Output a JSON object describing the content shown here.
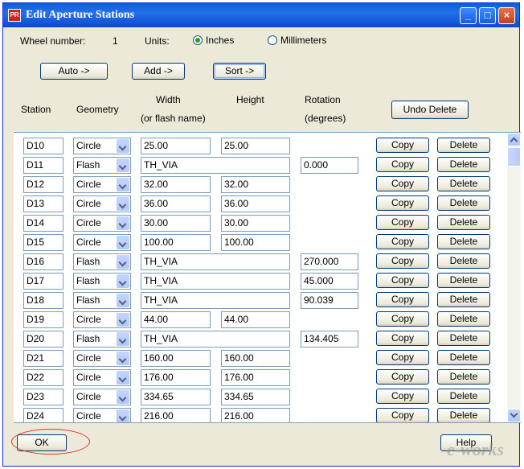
{
  "window": {
    "title": "Edit Aperture Stations",
    "controls": [
      "_",
      "□",
      "×"
    ]
  },
  "header": {
    "wheel_label": "Wheel number:",
    "wheel_value": "1",
    "units_label": "Units:",
    "units_options": [
      "Inches",
      "Millimeters"
    ],
    "units_selected": "Inches"
  },
  "toolbar": {
    "auto_label": "Auto ->",
    "add_label": "Add ->",
    "sort_label": "Sort ->",
    "undo_delete_label": "Undo Delete"
  },
  "columns": {
    "station": "Station",
    "geometry": "Geometry",
    "width": "Width",
    "width_sub": "(or flash name)",
    "height": "Height",
    "rotation": "Rotation",
    "rotation_sub": "(degrees)"
  },
  "row_buttons": {
    "copy": "Copy",
    "delete": "Delete"
  },
  "rows": [
    {
      "station": "D10",
      "geometry": "Circle",
      "width": "25.00",
      "height": "25.00",
      "rotation": ""
    },
    {
      "station": "D11",
      "geometry": "Flash",
      "width": "TH_VIA",
      "height": "",
      "rotation": "0.000"
    },
    {
      "station": "D12",
      "geometry": "Circle",
      "width": "32.00",
      "height": "32.00",
      "rotation": ""
    },
    {
      "station": "D13",
      "geometry": "Circle",
      "width": "36.00",
      "height": "36.00",
      "rotation": ""
    },
    {
      "station": "D14",
      "geometry": "Circle",
      "width": "30.00",
      "height": "30.00",
      "rotation": ""
    },
    {
      "station": "D15",
      "geometry": "Circle",
      "width": "100.00",
      "height": "100.00",
      "rotation": ""
    },
    {
      "station": "D16",
      "geometry": "Flash",
      "width": "TH_VIA",
      "height": "",
      "rotation": "270.000"
    },
    {
      "station": "D17",
      "geometry": "Flash",
      "width": "TH_VIA",
      "height": "",
      "rotation": "45.000"
    },
    {
      "station": "D18",
      "geometry": "Flash",
      "width": "TH_VIA",
      "height": "",
      "rotation": "90.039"
    },
    {
      "station": "D19",
      "geometry": "Circle",
      "width": "44.00",
      "height": "44.00",
      "rotation": ""
    },
    {
      "station": "D20",
      "geometry": "Flash",
      "width": "TH_VIA",
      "height": "",
      "rotation": "134.405"
    },
    {
      "station": "D21",
      "geometry": "Circle",
      "width": "160.00",
      "height": "160.00",
      "rotation": ""
    },
    {
      "station": "D22",
      "geometry": "Circle",
      "width": "176.00",
      "height": "176.00",
      "rotation": ""
    },
    {
      "station": "D23",
      "geometry": "Circle",
      "width": "334.65",
      "height": "334.65",
      "rotation": ""
    },
    {
      "station": "D24",
      "geometry": "Circle",
      "width": "216.00",
      "height": "216.00",
      "rotation": ""
    }
  ],
  "footer": {
    "ok_label": "OK",
    "help_label": "Help",
    "watermark": "e-works"
  }
}
